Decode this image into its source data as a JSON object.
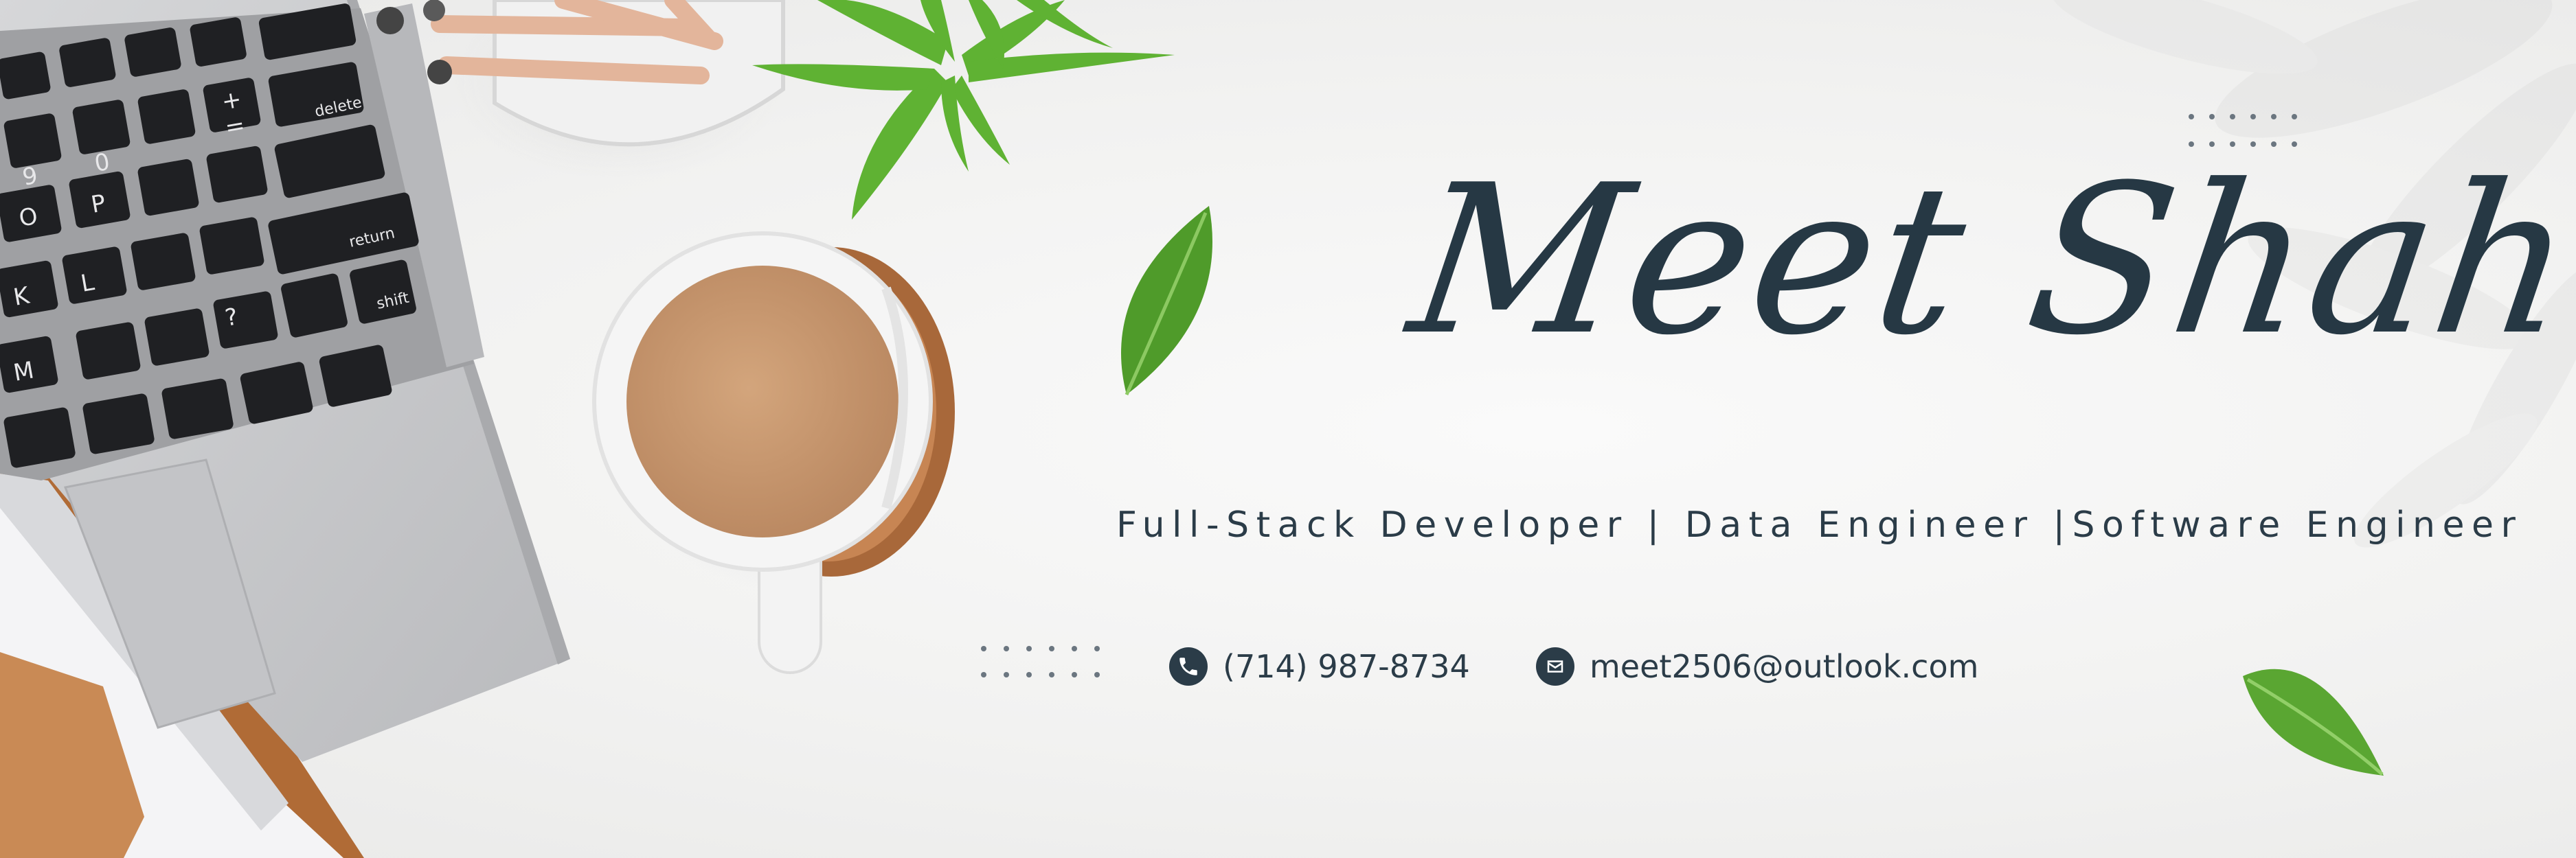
{
  "banner": {
    "name": "Meet Shah",
    "tagline": "Full-Stack Developer | Data Engineer |Software Engineer",
    "phone": "(714) 987-8734",
    "email": "meet2506@outlook.com",
    "phone_icon": "phone-icon",
    "email_icon": "envelope-icon"
  },
  "keyboard_keys": [
    {
      "label": "9"
    },
    {
      "label": "0"
    },
    {
      "label": "O"
    },
    {
      "label": "P"
    },
    {
      "label": "K"
    },
    {
      "label": "L"
    },
    {
      "label": "M"
    },
    {
      "label": "?"
    },
    {
      "label": "delete"
    },
    {
      "label": "return"
    },
    {
      "label": "shift"
    },
    {
      "label": "+"
    },
    {
      "label": "="
    }
  ],
  "colors": {
    "text": "#263844",
    "background": "#f2f2f1",
    "leaf": "#5aa632",
    "coffee": "#c89a72",
    "laptop": "#c9cacc",
    "wood": "#a8683a"
  }
}
